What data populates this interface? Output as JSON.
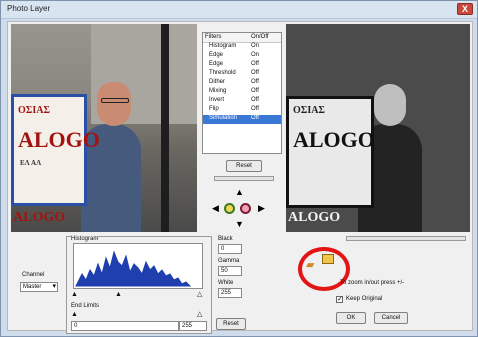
{
  "window": {
    "title": "Photo Layer",
    "close_glyph": "X"
  },
  "left_photo": {
    "sign_line1": "ΟΣΙΑΣ",
    "sign_line2": "ALOGO",
    "sign_line3": "ΕΛ ΑΛ",
    "sign_line4": "ALOGO"
  },
  "right_photo": {
    "sign_line1": "ΟΣΙΑΣ",
    "sign_line2": "ALOGO",
    "sign_line3": "ALOGO"
  },
  "filters": {
    "headers": [
      "Filters",
      "On/Off"
    ],
    "rows": [
      {
        "name": "Histogram",
        "value": "On"
      },
      {
        "name": "Edge",
        "value": "On"
      },
      {
        "name": "Edge",
        "value": "Off"
      },
      {
        "name": "Threshold",
        "value": "Off"
      },
      {
        "name": "Dither",
        "value": "Off"
      },
      {
        "name": "Mixing",
        "value": "Off"
      },
      {
        "name": "Invert",
        "value": "Off"
      },
      {
        "name": "Flip",
        "value": "Off"
      },
      {
        "name": "Simulation",
        "value": "Off",
        "selected": true
      }
    ],
    "reset_label": "Reset"
  },
  "histogram": {
    "label": "Histogram",
    "end_limits_label": "End Limits",
    "min_value": "0",
    "max_value": "255"
  },
  "channel": {
    "label": "Channel",
    "value": "Master"
  },
  "levels": {
    "black_label": "Black",
    "black_value": "0",
    "gamma_label": "Gamma",
    "gamma_value": "50",
    "white_label": "White",
    "white_value": "255",
    "reset_label": "Reset"
  },
  "right_panel": {
    "zoom_text": "To zoom in/out press +/-",
    "keep_original_label": "Keep Original",
    "ok_label": "OK",
    "cancel_label": "Cancel"
  },
  "colors": {
    "highlight": "#e31414",
    "selection": "#3a78d6"
  }
}
